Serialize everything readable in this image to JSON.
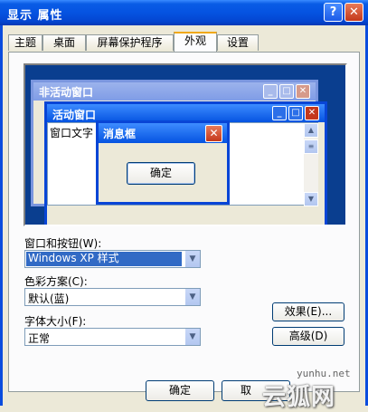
{
  "window": {
    "title": "显示 属性",
    "help_glyph": "?",
    "close_glyph": "✕"
  },
  "tabs": [
    {
      "label": "主题"
    },
    {
      "label": "桌面"
    },
    {
      "label": "屏幕保护程序"
    },
    {
      "label": "外观",
      "active": true
    },
    {
      "label": "设置"
    }
  ],
  "preview": {
    "inactive_window_title": "非活动窗口",
    "active_window_title": "活动窗口",
    "window_text": "窗口文字",
    "message_box_title": "消息框",
    "message_box_button": "确定"
  },
  "fields": {
    "windows_buttons": {
      "label": "窗口和按钮(W):",
      "value": "Windows XP 样式"
    },
    "color_scheme": {
      "label": "色彩方案(C):",
      "value": "默认(蓝)"
    },
    "font_size": {
      "label": "字体大小(F):",
      "value": "正常"
    }
  },
  "buttons": {
    "effects": "效果(E)...",
    "advanced": "高级(D)",
    "ok": "确定",
    "cancel_partial": "取"
  },
  "watermark": {
    "url": "yunhu.net",
    "brand": "云狐网"
  },
  "colors": {
    "titlebar": "#0553e1",
    "desktop_preview": "#0a3e8f",
    "close_button": "#c4381b",
    "selection": "#316ac5"
  }
}
